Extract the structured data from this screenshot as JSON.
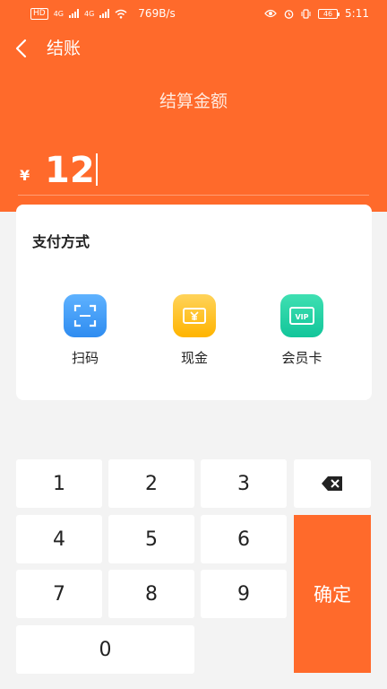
{
  "statusbar": {
    "sim": "HD",
    "net1": "4G",
    "net2": "4G",
    "speed": "769B/s",
    "battery": "46",
    "time": "5:11"
  },
  "header": {
    "title": "结账"
  },
  "amount": {
    "label": "结算金额",
    "currency": "¥",
    "value": "12"
  },
  "payment": {
    "title": "支付方式",
    "methods": [
      {
        "label": "扫码",
        "icon": "scan-icon"
      },
      {
        "label": "现金",
        "icon": "cash-icon"
      },
      {
        "label": "会员卡",
        "icon": "vip-card-icon",
        "badge": "VIP"
      }
    ]
  },
  "keypad": {
    "keys": [
      "1",
      "2",
      "3",
      "4",
      "5",
      "6",
      "7",
      "8",
      "9",
      "0"
    ],
    "delete_icon": "backspace-icon",
    "confirm": "确定"
  },
  "colors": {
    "accent": "#ff6a2b"
  }
}
